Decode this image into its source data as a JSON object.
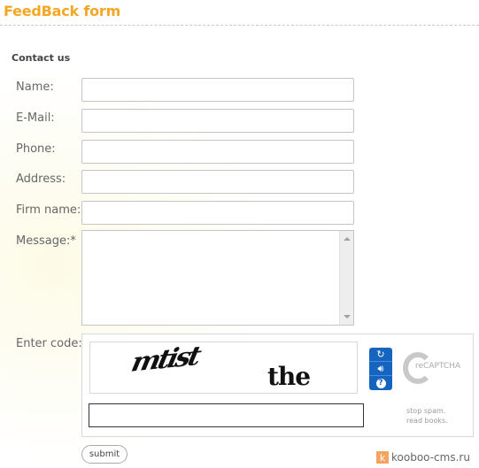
{
  "page": {
    "title": "FeedBack form",
    "section_title": "Contact us"
  },
  "form": {
    "fields": [
      {
        "label": "Name:",
        "value": ""
      },
      {
        "label": "E-Mail:",
        "value": ""
      },
      {
        "label": "Phone:",
        "value": ""
      },
      {
        "label": "Address:",
        "value": ""
      },
      {
        "label": "Firm name:",
        "value": ""
      }
    ],
    "message": {
      "label": "Message:*",
      "value": ""
    },
    "captcha": {
      "label": "Enter code:",
      "word1": "mtist",
      "word2": "the",
      "value": "",
      "icons": [
        "refresh-icon",
        "audio-icon",
        "help-icon"
      ],
      "logo_text": "reCAPTCHA",
      "logo_prefix": "re",
      "tagline_line1": "stop spam.",
      "tagline_line2": "read books."
    },
    "submit_label": "submit"
  },
  "footer": {
    "brand_letter": "k",
    "brand_text": "kooboo-cms.ru"
  },
  "colors": {
    "title": "#f5a623",
    "captcha_buttons": "#1565c0"
  }
}
